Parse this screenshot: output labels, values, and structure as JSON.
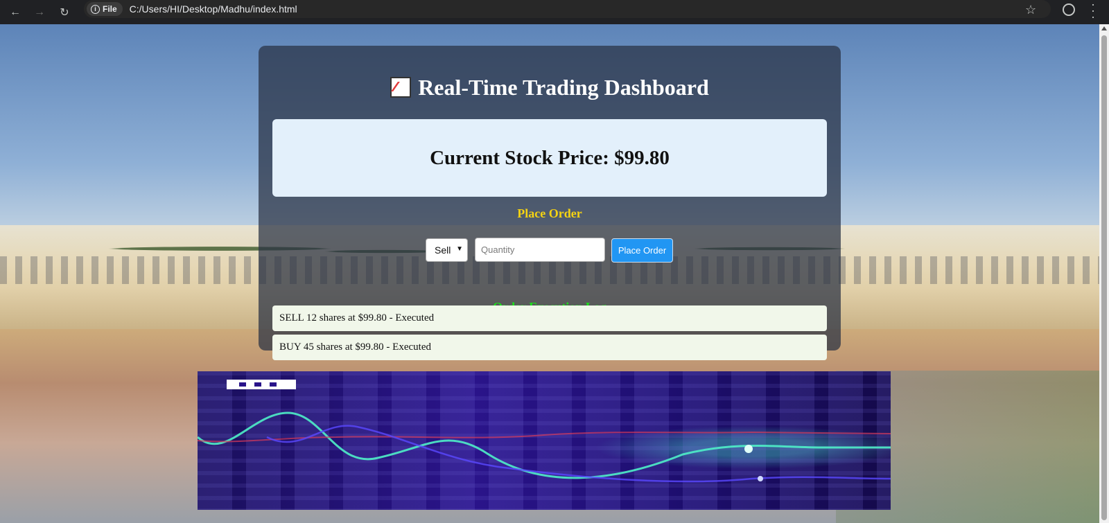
{
  "browser": {
    "chip_label": "File",
    "url": "C:/Users/HI/Desktop/Madhu/index.html"
  },
  "dashboard": {
    "title": "Real-Time Trading Dashboard",
    "title_icon": "chart-increasing-icon",
    "price_label": "Current Stock Price: $99.80",
    "place_order_heading": "Place Order",
    "order_type": {
      "selected": "Sell",
      "options": [
        "Sell"
      ]
    },
    "quantity": {
      "placeholder": "Quantity",
      "value": ""
    },
    "place_order_button": "Place Order",
    "log_heading": "Order Execution Log",
    "log": [
      "SELL 12 shares at $99.80 - Executed",
      "BUY 45 shares at $99.80 - Executed"
    ]
  },
  "colors": {
    "heading_yellow": "#f5d312",
    "heading_green": "#19e219",
    "button_blue": "#2196f3",
    "price_card": "#e3f0fb",
    "log_item": "#f1f7ea"
  }
}
